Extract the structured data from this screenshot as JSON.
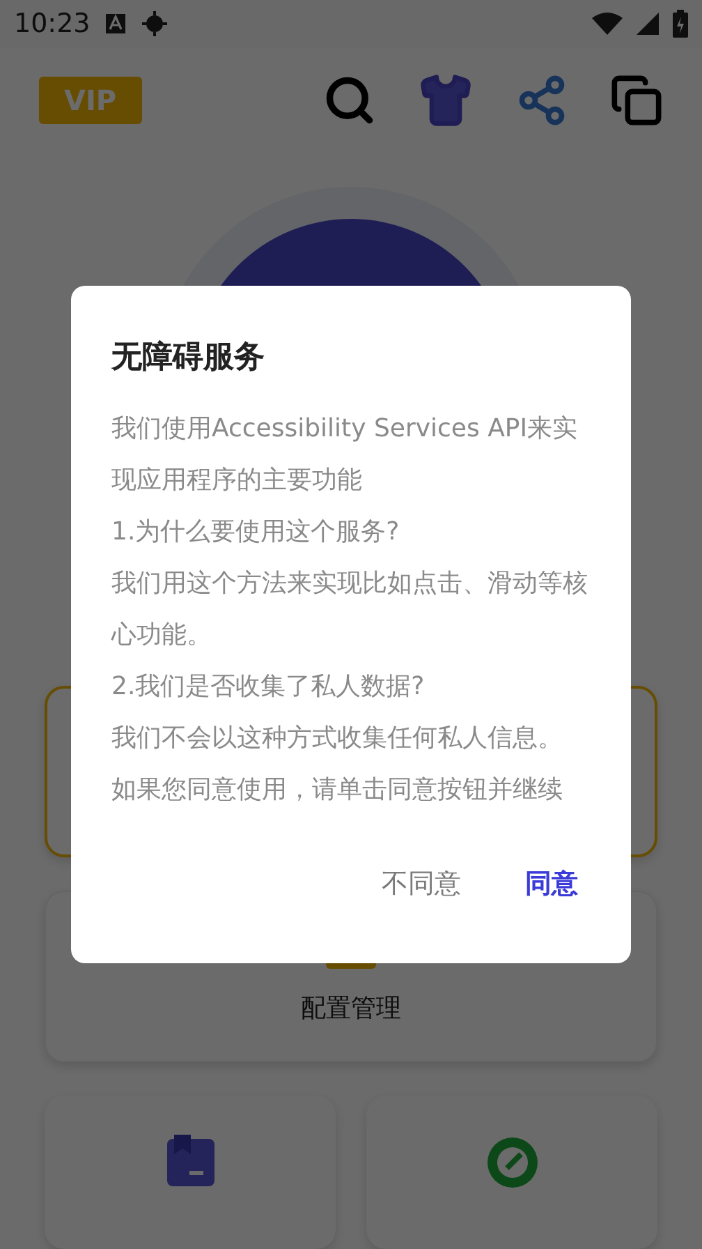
{
  "status_bar": {
    "time": "10:23"
  },
  "toolbar": {
    "badge": "VIP"
  },
  "cards": [
    {
      "kind": "blank"
    },
    {
      "kind": "config",
      "label": "配置管理"
    }
  ],
  "dialog": {
    "title": "无障碍服务",
    "paragraphs": [
      "我们使用Accessibility Services API来实现应用程序的主要功能",
      "1.为什么要使用这个服务?",
      "我们用这个方法来实现比如点击、滑动等核心功能。",
      "2.我们是否收集了私人数据?",
      "我们不会以这种方式收集任何私人信息。",
      "如果您同意使用，请单击同意按钮并继续"
    ],
    "buttons": [
      {
        "label": "不同意",
        "primary": false
      },
      {
        "label": "同意",
        "primary": true
      }
    ]
  }
}
